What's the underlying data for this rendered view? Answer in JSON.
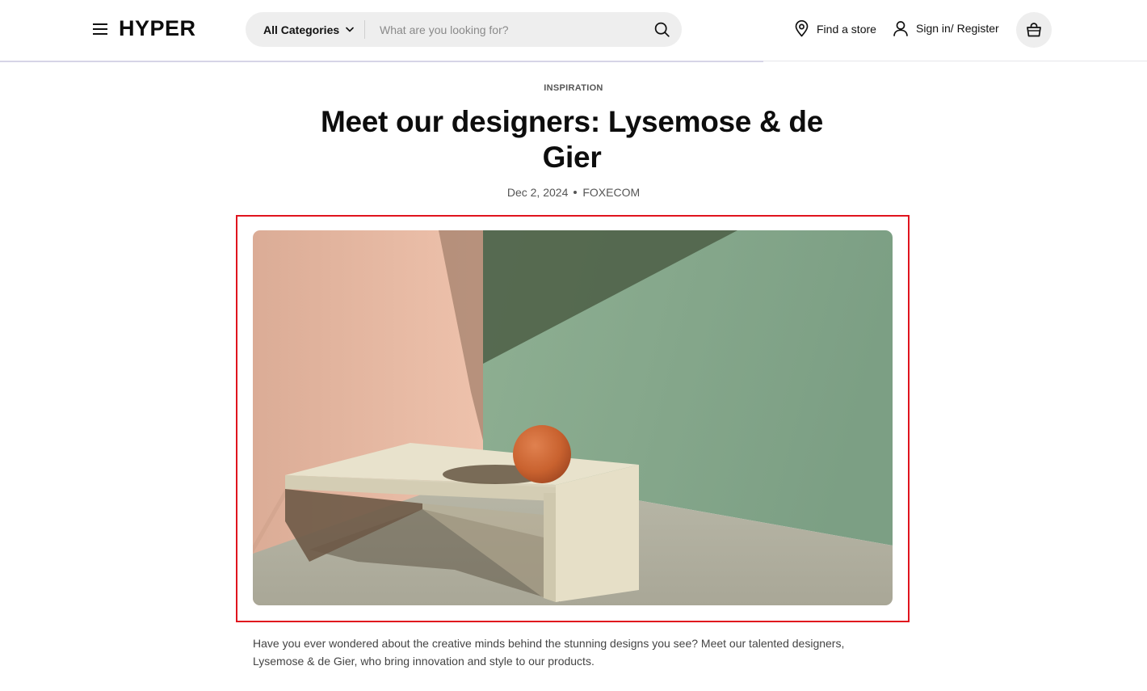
{
  "header": {
    "logo": "HYPER",
    "category_select": "All Categories",
    "search_placeholder": "What are you looking for?",
    "find_store": "Find a store",
    "sign_in": "Sign in/ Register"
  },
  "article": {
    "category": "INSPIRATION",
    "title": "Meet our designers: Lysemose & de Gier",
    "date": "Dec 2, 2024",
    "author": "FOXECOM",
    "intro": "Have you ever wondered about the creative minds behind the stunning designs you see? Meet our talented designers, Lysemose & de Gier, who bring innovation and style to our products."
  },
  "colors": {
    "accent_highlight": "#e0141e",
    "search_bg": "#eeeeee",
    "wall_pink": "#e4b8a0",
    "wall_green": "#82a588",
    "sphere": "#d0683a"
  },
  "icons": [
    "menu-icon",
    "chevron-down-icon",
    "search-icon",
    "location-pin-icon",
    "user-icon",
    "shopping-bag-icon"
  ]
}
